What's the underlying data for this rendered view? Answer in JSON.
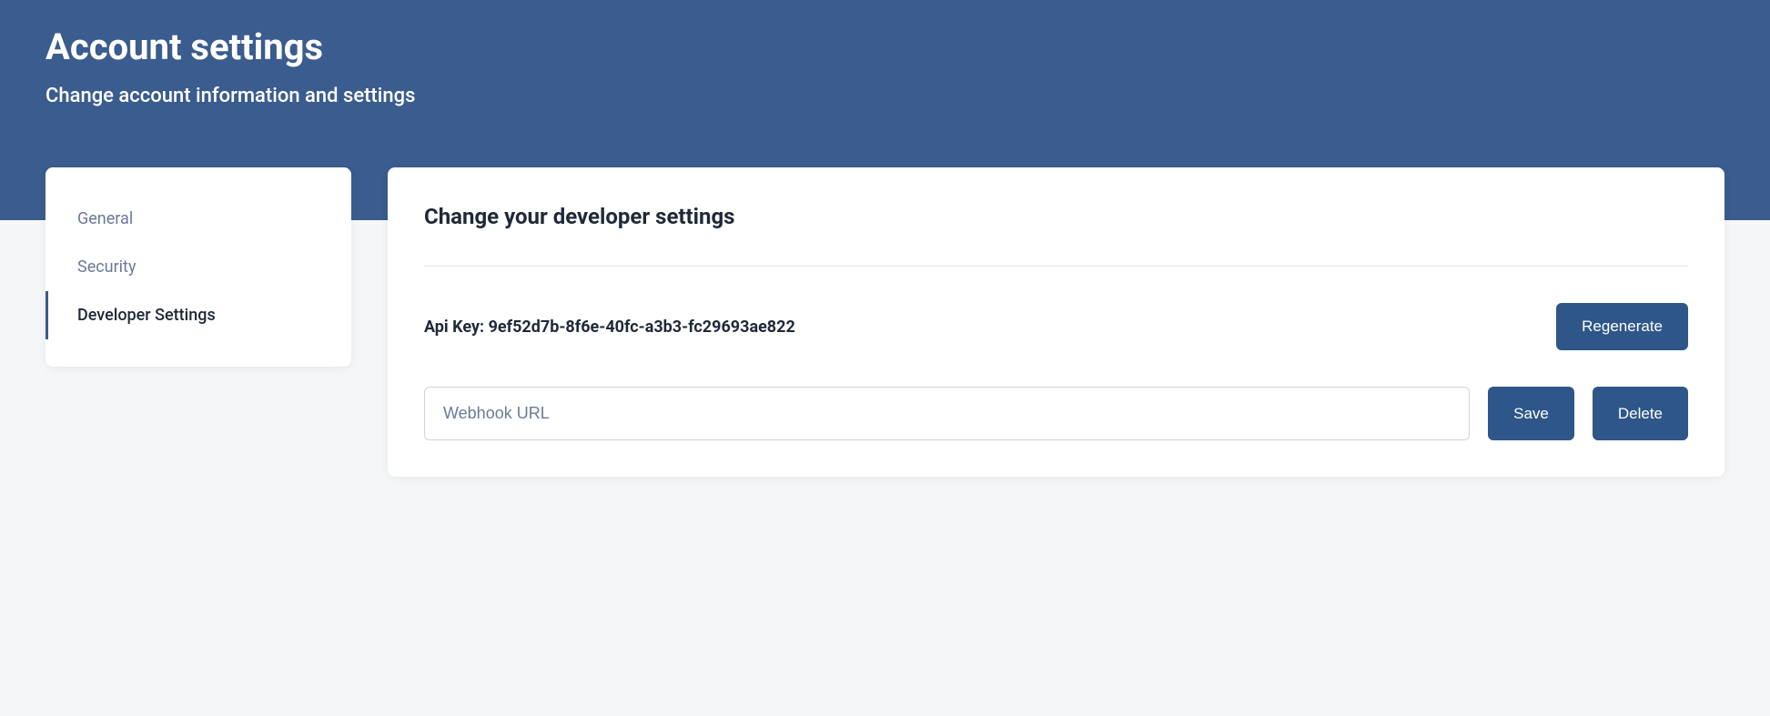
{
  "header": {
    "title": "Account settings",
    "subtitle": "Change account information and settings"
  },
  "sidebar": {
    "items": [
      {
        "label": "General",
        "active": false
      },
      {
        "label": "Security",
        "active": false
      },
      {
        "label": "Developer Settings",
        "active": true
      }
    ]
  },
  "main": {
    "title": "Change your developer settings",
    "api_key_label": "Api Key: 9ef52d7b-8f6e-40fc-a3b3-fc29693ae822",
    "regenerate_label": "Regenerate",
    "webhook_placeholder": "Webhook URL",
    "webhook_value": "",
    "save_label": "Save",
    "delete_label": "Delete"
  }
}
